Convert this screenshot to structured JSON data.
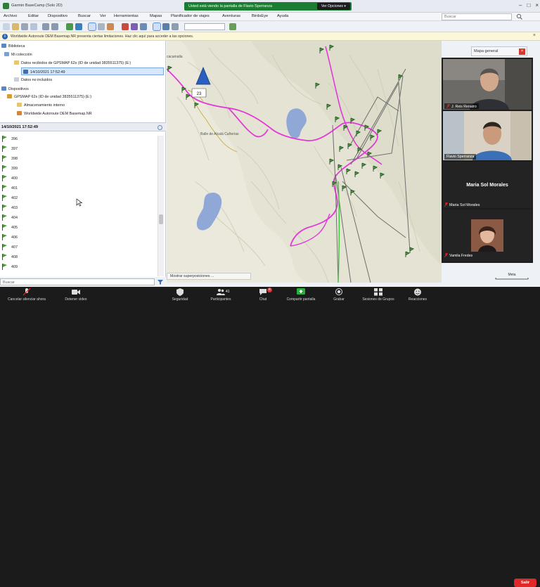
{
  "window": {
    "title": "Garmin BaseCamp (Solo 2D)",
    "controls": [
      "–",
      "□",
      "×"
    ]
  },
  "share": {
    "banner": "Usted está viendo la pantalla de Flavio Sperranza",
    "view_options": "Ver Opciones ▾"
  },
  "menu": {
    "items": [
      "Archivo",
      "Editar",
      "Dispositivo",
      "Buscar",
      "Ver",
      "Herramientas",
      "Mapas",
      "Planificador de viajes",
      "Aventuras",
      "BirdsEye",
      "Ayuda"
    ],
    "search_placeholder": "Buscar"
  },
  "toolbar": {
    "icons": [
      "new-icon",
      "open-icon",
      "print-icon",
      "undo-icon",
      "redo-icon",
      "send-to-device-icon",
      "receive-from-device-icon",
      "hand-tool-icon",
      "zoom-tool-icon",
      "eraser-icon",
      "route-tool-icon",
      "track-tool-icon",
      "measure-tool-icon",
      "waypoint-tool-icon",
      "select-tool-icon",
      "area-tool-icon",
      "profile-dropdown",
      "find-address-icon"
    ]
  },
  "notice": {
    "text": "Worldwide Autoroute DEM Basemap.NR presenta ciertas limitaciones. Haz clic aquí para acceder a las opciones.",
    "close": "×"
  },
  "library": {
    "section_biblioteca": "Biblioteca",
    "my_collection": "Mi colección",
    "received_data": "Datos recibidos de GPSMAP 62s (ID de unidad 3835511375) (E:)",
    "selected_item": "14/10/2021 17:52:49",
    "unlisted_data": "Datos no incluidos",
    "section_devices": "Dispositivos",
    "device": "GPSMAP 62s (ID de unidad 3835511375) (E:)",
    "internal_storage": "Almacenamiento interno",
    "basemap": "Worldwide Autoroute DEM Basemap.NR"
  },
  "list": {
    "header": "14/10/2021 17:52:49",
    "waypoints": [
      "396",
      "397",
      "398",
      "399",
      "400",
      "401",
      "402",
      "403",
      "404",
      "405",
      "406",
      "407",
      "408",
      "409"
    ],
    "search_placeholder": "Buscar"
  },
  "map": {
    "label_town": "cacamalla",
    "label_place": "Balle de Alcalá Cañerías",
    "marker_number": "23",
    "overview_title": "Mapa general",
    "overview_close": "×",
    "bottom_bar": "Mostrar superposiciones ...",
    "scale": "Meta"
  },
  "participants": [
    {
      "name": "J. Reis Renatro",
      "muted": true
    },
    {
      "name": "Flavio Sperranza",
      "muted": false
    },
    {
      "name": "Maria Sol Morales",
      "muted": true
    },
    {
      "name": "Vamila Fredes",
      "muted": true
    }
  ],
  "zoom_bar": {
    "items": [
      {
        "label": "Cancelar silenciar ahora",
        "icon": "mic-off-icon"
      },
      {
        "label": "Detener video",
        "icon": "video-icon"
      },
      {
        "label": "Seguridad",
        "icon": "shield-icon"
      },
      {
        "label": "Participantes",
        "icon": "participants-icon",
        "count": "41"
      },
      {
        "label": "Chat",
        "icon": "chat-icon",
        "badge": "6"
      },
      {
        "label": "Compartir pantalla",
        "icon": "share-screen-icon"
      },
      {
        "label": "Grabar",
        "icon": "record-icon"
      },
      {
        "label": "Sesiones de Grupos",
        "icon": "breakout-icon"
      },
      {
        "label": "Reacciones",
        "icon": "reactions-icon"
      }
    ],
    "leave": "Salir"
  },
  "colors": {
    "route_magenta": "#e23ad6",
    "track_gray": "#6e6e6e",
    "track_green": "#3ec43e",
    "water_blue": "#8fa8d6",
    "zoom_green": "#1b7d31",
    "leave_red": "#e02828"
  }
}
